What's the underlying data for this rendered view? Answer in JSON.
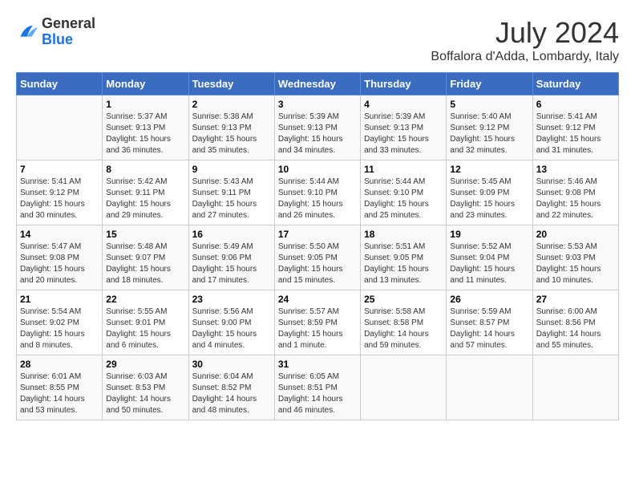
{
  "logo": {
    "general": "General",
    "blue": "Blue"
  },
  "title": "July 2024",
  "location": "Boffalora d'Adda, Lombardy, Italy",
  "weekdays": [
    "Sunday",
    "Monday",
    "Tuesday",
    "Wednesday",
    "Thursday",
    "Friday",
    "Saturday"
  ],
  "weeks": [
    [
      {
        "day": "",
        "info": ""
      },
      {
        "day": "1",
        "info": "Sunrise: 5:37 AM\nSunset: 9:13 PM\nDaylight: 15 hours\nand 36 minutes."
      },
      {
        "day": "2",
        "info": "Sunrise: 5:38 AM\nSunset: 9:13 PM\nDaylight: 15 hours\nand 35 minutes."
      },
      {
        "day": "3",
        "info": "Sunrise: 5:39 AM\nSunset: 9:13 PM\nDaylight: 15 hours\nand 34 minutes."
      },
      {
        "day": "4",
        "info": "Sunrise: 5:39 AM\nSunset: 9:13 PM\nDaylight: 15 hours\nand 33 minutes."
      },
      {
        "day": "5",
        "info": "Sunrise: 5:40 AM\nSunset: 9:12 PM\nDaylight: 15 hours\nand 32 minutes."
      },
      {
        "day": "6",
        "info": "Sunrise: 5:41 AM\nSunset: 9:12 PM\nDaylight: 15 hours\nand 31 minutes."
      }
    ],
    [
      {
        "day": "7",
        "info": "Sunrise: 5:41 AM\nSunset: 9:12 PM\nDaylight: 15 hours\nand 30 minutes."
      },
      {
        "day": "8",
        "info": "Sunrise: 5:42 AM\nSunset: 9:11 PM\nDaylight: 15 hours\nand 29 minutes."
      },
      {
        "day": "9",
        "info": "Sunrise: 5:43 AM\nSunset: 9:11 PM\nDaylight: 15 hours\nand 27 minutes."
      },
      {
        "day": "10",
        "info": "Sunrise: 5:44 AM\nSunset: 9:10 PM\nDaylight: 15 hours\nand 26 minutes."
      },
      {
        "day": "11",
        "info": "Sunrise: 5:44 AM\nSunset: 9:10 PM\nDaylight: 15 hours\nand 25 minutes."
      },
      {
        "day": "12",
        "info": "Sunrise: 5:45 AM\nSunset: 9:09 PM\nDaylight: 15 hours\nand 23 minutes."
      },
      {
        "day": "13",
        "info": "Sunrise: 5:46 AM\nSunset: 9:08 PM\nDaylight: 15 hours\nand 22 minutes."
      }
    ],
    [
      {
        "day": "14",
        "info": "Sunrise: 5:47 AM\nSunset: 9:08 PM\nDaylight: 15 hours\nand 20 minutes."
      },
      {
        "day": "15",
        "info": "Sunrise: 5:48 AM\nSunset: 9:07 PM\nDaylight: 15 hours\nand 18 minutes."
      },
      {
        "day": "16",
        "info": "Sunrise: 5:49 AM\nSunset: 9:06 PM\nDaylight: 15 hours\nand 17 minutes."
      },
      {
        "day": "17",
        "info": "Sunrise: 5:50 AM\nSunset: 9:05 PM\nDaylight: 15 hours\nand 15 minutes."
      },
      {
        "day": "18",
        "info": "Sunrise: 5:51 AM\nSunset: 9:05 PM\nDaylight: 15 hours\nand 13 minutes."
      },
      {
        "day": "19",
        "info": "Sunrise: 5:52 AM\nSunset: 9:04 PM\nDaylight: 15 hours\nand 11 minutes."
      },
      {
        "day": "20",
        "info": "Sunrise: 5:53 AM\nSunset: 9:03 PM\nDaylight: 15 hours\nand 10 minutes."
      }
    ],
    [
      {
        "day": "21",
        "info": "Sunrise: 5:54 AM\nSunset: 9:02 PM\nDaylight: 15 hours\nand 8 minutes."
      },
      {
        "day": "22",
        "info": "Sunrise: 5:55 AM\nSunset: 9:01 PM\nDaylight: 15 hours\nand 6 minutes."
      },
      {
        "day": "23",
        "info": "Sunrise: 5:56 AM\nSunset: 9:00 PM\nDaylight: 15 hours\nand 4 minutes."
      },
      {
        "day": "24",
        "info": "Sunrise: 5:57 AM\nSunset: 8:59 PM\nDaylight: 15 hours\nand 1 minute."
      },
      {
        "day": "25",
        "info": "Sunrise: 5:58 AM\nSunset: 8:58 PM\nDaylight: 14 hours\nand 59 minutes."
      },
      {
        "day": "26",
        "info": "Sunrise: 5:59 AM\nSunset: 8:57 PM\nDaylight: 14 hours\nand 57 minutes."
      },
      {
        "day": "27",
        "info": "Sunrise: 6:00 AM\nSunset: 8:56 PM\nDaylight: 14 hours\nand 55 minutes."
      }
    ],
    [
      {
        "day": "28",
        "info": "Sunrise: 6:01 AM\nSunset: 8:55 PM\nDaylight: 14 hours\nand 53 minutes."
      },
      {
        "day": "29",
        "info": "Sunrise: 6:03 AM\nSunset: 8:53 PM\nDaylight: 14 hours\nand 50 minutes."
      },
      {
        "day": "30",
        "info": "Sunrise: 6:04 AM\nSunset: 8:52 PM\nDaylight: 14 hours\nand 48 minutes."
      },
      {
        "day": "31",
        "info": "Sunrise: 6:05 AM\nSunset: 8:51 PM\nDaylight: 14 hours\nand 46 minutes."
      },
      {
        "day": "",
        "info": ""
      },
      {
        "day": "",
        "info": ""
      },
      {
        "day": "",
        "info": ""
      }
    ]
  ]
}
